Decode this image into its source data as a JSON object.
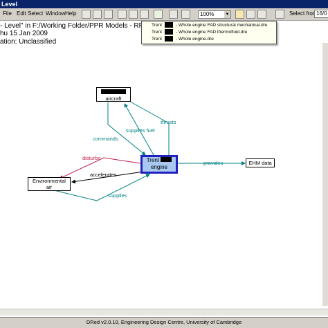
{
  "window": {
    "title": "Level"
  },
  "menu": [
    "File",
    "Edit",
    "Select",
    "Window",
    "Help"
  ],
  "toolbar": {
    "zoom_value": "100%",
    "select_from_label": "Select from",
    "select_from_value": "16/0"
  },
  "header_info": {
    "line1": "- Level\" in F:/Working Folder/PPR Models - RR",
    "line2": "hu 15 Jan 2009",
    "line3": "ation: Unclassified"
  },
  "popup": {
    "items": [
      {
        "prefix": "Trent",
        "text": "- Whole engine FAD structural mechanical.dre"
      },
      {
        "prefix": "Trent",
        "text": "- Whole engine FAD thermofluid.dre"
      },
      {
        "prefix": "Trent",
        "text": "- Whole engine.dre"
      }
    ]
  },
  "nodes": {
    "aircraft": "aircraft",
    "trent_line1": "Trent",
    "trent_line2": "engine",
    "environmental_line1": "Environmental",
    "environmental_line2": "air",
    "ehm": "EHM data"
  },
  "edges": {
    "thrusts": "thrusts",
    "supplies_fuel": "supplies fuel",
    "commands": "commands",
    "disturbs": "disturbs",
    "accelerates": "accelerates",
    "provides": "provides",
    "supplies": "supplies"
  },
  "status_bar": "DRed v2.0.10, Engineering Design Centre, University of Cambridge",
  "colors": {
    "teal": "#008080",
    "crimson": "#c0204a",
    "selected_fill": "#a8c8f0",
    "selected_border": "#2020c0"
  }
}
